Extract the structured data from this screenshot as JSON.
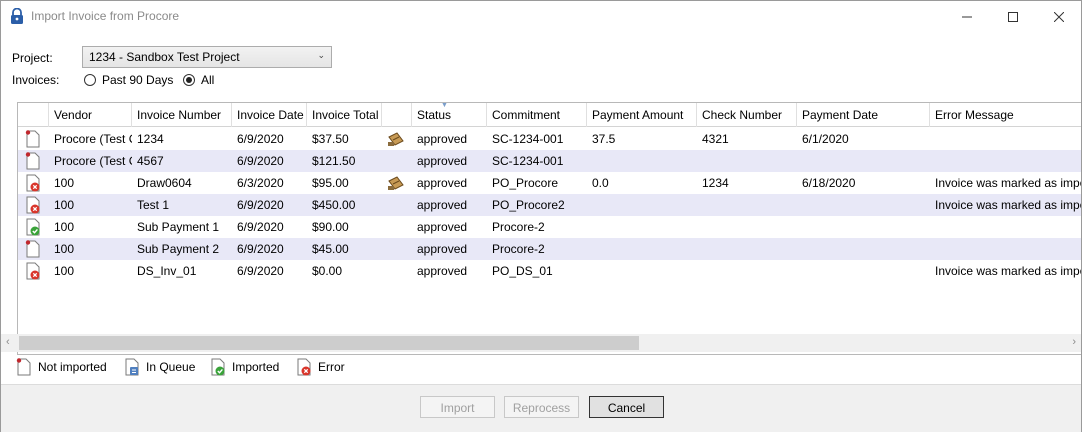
{
  "window": {
    "title": "Import Invoice from Procore"
  },
  "project": {
    "label": "Project:",
    "selected": "1234 - Sandbox Test Project"
  },
  "invoices": {
    "label": "Invoices:",
    "options": [
      {
        "label": "Past 90 Days",
        "checked": false
      },
      {
        "label": "All",
        "checked": true
      }
    ]
  },
  "grid": {
    "columns": [
      "Vendor",
      "Invoice Number",
      "Invoice Date",
      "Invoice Total",
      "",
      "Status",
      "Commitment",
      "Payment Amount",
      "Check Number",
      "Payment Date",
      "Error Message"
    ],
    "rows": [
      {
        "icon": "not-imported",
        "attachment": true,
        "cells": [
          "Procore (Test Co",
          "1234",
          "6/9/2020",
          "$37.50",
          "",
          "approved",
          "SC-1234-001",
          "37.5",
          "4321",
          "6/1/2020",
          ""
        ]
      },
      {
        "icon": "not-imported",
        "attachment": false,
        "cells": [
          "Procore (Test Co",
          "4567",
          "6/9/2020",
          "$121.50",
          "",
          "approved",
          "SC-1234-001",
          "",
          "",
          "",
          ""
        ]
      },
      {
        "icon": "error",
        "attachment": true,
        "cells": [
          "100",
          "Draw0604",
          "6/3/2020",
          "$95.00",
          "",
          "approved",
          "PO_Procore",
          "0.0",
          "1234",
          "6/18/2020",
          "Invoice was marked as imported"
        ]
      },
      {
        "icon": "error",
        "attachment": false,
        "cells": [
          "100",
          "Test 1",
          "6/9/2020",
          "$450.00",
          "",
          "approved",
          "PO_Procore2",
          "",
          "",
          "",
          "Invoice was marked as imported"
        ]
      },
      {
        "icon": "imported",
        "attachment": false,
        "cells": [
          "100",
          "Sub Payment 1",
          "6/9/2020",
          "$90.00",
          "",
          "approved",
          "Procore-2",
          "",
          "",
          "",
          ""
        ]
      },
      {
        "icon": "not-imported",
        "attachment": false,
        "cells": [
          "100",
          "Sub Payment 2",
          "6/9/2020",
          "$45.00",
          "",
          "approved",
          "Procore-2",
          "",
          "",
          "",
          ""
        ]
      },
      {
        "icon": "error",
        "attachment": false,
        "cells": [
          "100",
          "DS_Inv_01",
          "6/9/2020",
          "$0.00",
          "",
          "approved",
          "PO_DS_01",
          "",
          "",
          "",
          "Invoice was marked as imported"
        ]
      }
    ]
  },
  "legend": [
    {
      "label": "Not imported",
      "icon": "not-imported-icon"
    },
    {
      "label": "In Queue",
      "icon": "in-queue-icon"
    },
    {
      "label": "Imported",
      "icon": "imported-icon"
    },
    {
      "label": "Error",
      "icon": "error-icon"
    }
  ],
  "buttons": {
    "import": "Import",
    "reprocess": "Reprocess",
    "cancel": "Cancel"
  },
  "colors": {
    "alt_row": "#e8e8f7",
    "error_red": "#d9362b",
    "ok_green": "#3aa33a"
  }
}
